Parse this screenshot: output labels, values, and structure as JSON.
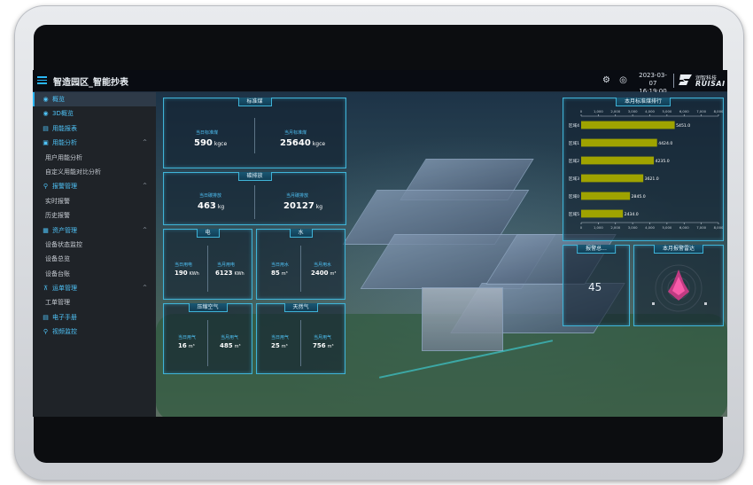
{
  "header": {
    "title": "智造园区_智能抄表",
    "date": "2023-03-07",
    "time": "16:19:00",
    "logo_cn": "润智科技",
    "logo_en": "RUISAI"
  },
  "sidebar": {
    "items": [
      {
        "label": "概览",
        "icon": "overview-icon"
      },
      {
        "label": "3D概览",
        "icon": "cube-icon"
      },
      {
        "label": "用能报表",
        "icon": "report-icon"
      },
      {
        "label": "用能分析",
        "icon": "analysis-icon"
      },
      {
        "label": "用户用能分析"
      },
      {
        "label": "自定义用能对比分析"
      },
      {
        "label": "报警管理",
        "icon": "link-icon"
      },
      {
        "label": "实时报警"
      },
      {
        "label": "历史报警"
      },
      {
        "label": "资产管理",
        "icon": "database-icon"
      },
      {
        "label": "设备状态监控"
      },
      {
        "label": "设备总览"
      },
      {
        "label": "设备台账"
      },
      {
        "label": "运单管理",
        "icon": "org-icon"
      },
      {
        "label": "工单管理"
      },
      {
        "label": "电子手册",
        "icon": "book-icon"
      },
      {
        "label": "视频监控",
        "icon": "link-icon"
      }
    ]
  },
  "panels": {
    "coal": {
      "title": "标准煤",
      "left_label": "当日标准煤",
      "left_value": "590",
      "left_unit": "kgce",
      "right_label": "当月标准煤",
      "right_value": "25640",
      "right_unit": "kgce"
    },
    "carbon": {
      "title": "碳排放",
      "left_label": "当日碳排放",
      "left_value": "463",
      "left_unit": "kg",
      "right_label": "当月碳排放",
      "right_value": "20127",
      "right_unit": "kg"
    },
    "electric": {
      "title": "电",
      "left_label": "当日用电",
      "left_value": "190",
      "left_unit": "KWh",
      "right_label": "当月用电",
      "right_value": "6123",
      "right_unit": "KWh"
    },
    "water": {
      "title": "水",
      "left_label": "当日用水",
      "left_value": "85",
      "left_unit": "m³",
      "right_label": "当月用水",
      "right_value": "2400",
      "right_unit": "m³"
    },
    "air": {
      "title": "压缩空气",
      "left_label": "当日用气",
      "left_value": "16",
      "left_unit": "m³",
      "right_label": "当月用气",
      "right_value": "485",
      "right_unit": "m³"
    },
    "gas": {
      "title": "天然气",
      "left_label": "当日用气",
      "left_value": "25",
      "left_unit": "m³",
      "right_label": "当月用气",
      "right_value": "756",
      "right_unit": "m³"
    },
    "alarm_total": {
      "title": "报警总...",
      "value": "45"
    },
    "alarm_radar": {
      "title": "本月报警雷达"
    }
  },
  "chart_data": {
    "type": "bar",
    "orientation": "horizontal",
    "title": "本月标准煤排行",
    "categories": [
      "区域4",
      "区域1",
      "区域2",
      "区域3",
      "区域0",
      "区域5"
    ],
    "values": [
      5451.0,
      4424.0,
      4235.0,
      3621.0,
      2845.0,
      2434.0
    ],
    "value_labels": [
      "5451.0",
      "4424.0",
      "4235.0",
      "3621.0",
      "2845.0",
      "2434.0"
    ],
    "xlim": [
      0,
      8000
    ],
    "ticks": [
      "0",
      "1,000",
      "2,000",
      "3,000",
      "4,000",
      "5,000",
      "6,000",
      "7,000",
      "8,000"
    ],
    "bar_color": "#9fa300",
    "accent": "#29b6f6"
  }
}
